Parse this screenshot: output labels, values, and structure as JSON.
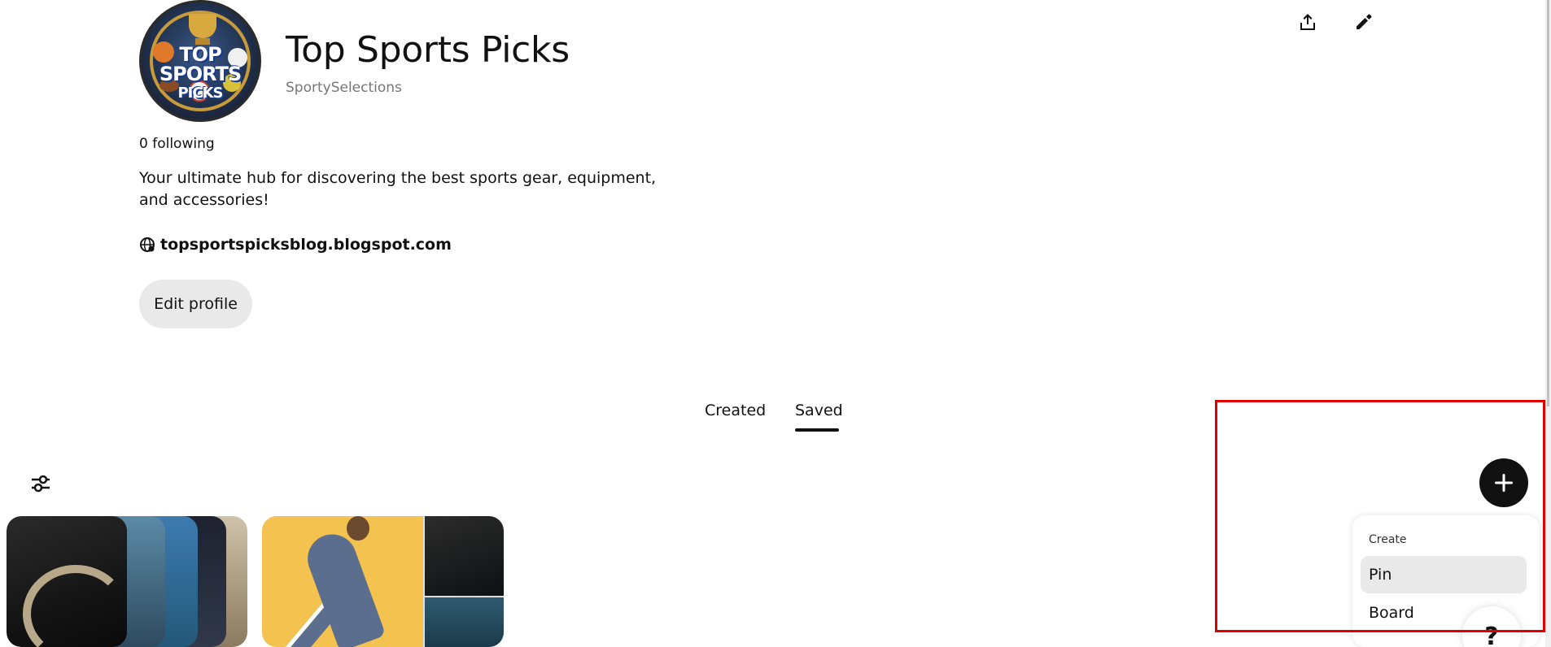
{
  "profile": {
    "name": "Top Sports Picks",
    "handle": "SportySelections",
    "following": "0 following",
    "bio": "Your ultimate hub for discovering the best sports gear, equipment, and accessories!",
    "website": "topsportspicksblog.blogspot.com",
    "avatar_text_line1": "TOP SPORTS",
    "avatar_text_line2": "PICKS"
  },
  "header": {
    "share_icon": "share-icon",
    "edit_icon": "pencil-icon"
  },
  "actions": {
    "edit_profile_label": "Edit profile"
  },
  "tabs": [
    {
      "label": "Created",
      "active": false
    },
    {
      "label": "Saved",
      "active": true
    }
  ],
  "toolbar": {
    "filter_icon": "sliders-icon"
  },
  "fab": {
    "icon": "plus-icon"
  },
  "create_menu": {
    "header": "Create",
    "items": [
      {
        "label": "Pin",
        "highlighted": true
      },
      {
        "label": "Board",
        "highlighted": false
      }
    ]
  },
  "help": {
    "label": "?"
  },
  "colors": {
    "accent": "#111111",
    "highlight_box": "#e00000",
    "button_bg": "#e9e9e9",
    "secondary_text": "#767676"
  }
}
